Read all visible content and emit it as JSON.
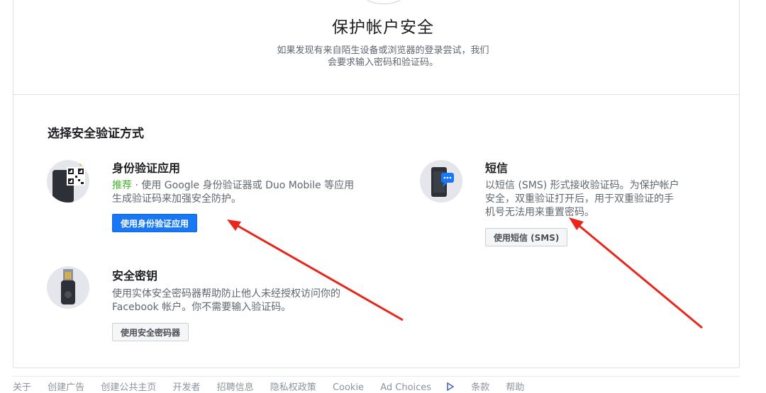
{
  "hero": {
    "title": "保护帐户安全",
    "subtitle_line1": "如果发现有来自陌生设备或浏览器的登录尝试，我们",
    "subtitle_line2": "会要求输入密码和验证码。"
  },
  "section": {
    "title": "选择安全验证方式"
  },
  "options": {
    "auth_app": {
      "title": "身份验证应用",
      "recommended": "推荐",
      "desc_line1": " · 使用 Google 身份验证器或 Duo Mobile 等应用",
      "desc_line2": "生成验证码来加强安全防护。",
      "button": "使用身份验证应用"
    },
    "sms": {
      "title": "短信",
      "desc_line1": "以短信 (SMS) 形式接收验证码。为保护帐户",
      "desc_line2": "安全，双重验证打开后，用于双重验证的手",
      "desc_line3": "机号无法用来重置密码。",
      "button": "使用短信 (SMS)"
    },
    "security_key": {
      "title": "安全密钥",
      "desc_line1": "使用实体安全密码器帮助防止他人未经授权访问你的",
      "desc_line2": "Facebook 帐户。你不需要输入验证码。",
      "button": "使用安全密码器"
    }
  },
  "footer": {
    "links": [
      "关于",
      "创建广告",
      "创建公共主页",
      "开发者",
      "招聘信息",
      "隐私权政策",
      "Cookie",
      "Ad Choices",
      "条款",
      "帮助"
    ]
  },
  "colors": {
    "primary": "#1877f2",
    "recommended": "#42b72a",
    "annotation_arrow": "#e8261c"
  }
}
